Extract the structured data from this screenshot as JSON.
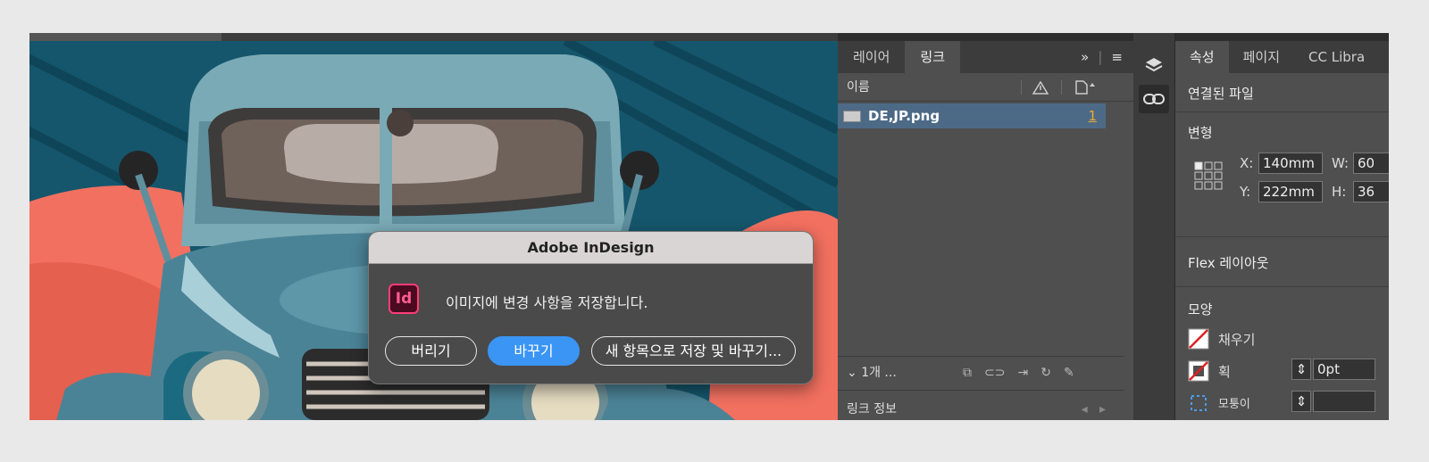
{
  "links_panel": {
    "tabs": [
      {
        "label": "레이어"
      },
      {
        "label": "링크"
      }
    ],
    "tools": {
      "expand": "»",
      "menu": "≡"
    },
    "column_name": "이름",
    "row": {
      "file_name": "DE,JP.png",
      "page": "1"
    },
    "footer": {
      "selection": "1개 ..."
    },
    "link_info": {
      "label": "링크 정보"
    }
  },
  "props_panel": {
    "tabs": [
      {
        "label": "속성"
      },
      {
        "label": "페이지"
      },
      {
        "label": "CC Libra"
      }
    ],
    "linked_file": "연결된 파일",
    "transform": {
      "title": "변형",
      "x_label": "X:",
      "x_value": "140mm",
      "w_label": "W:",
      "w_value": "60",
      "y_label": "Y:",
      "y_value": "222mm",
      "h_label": "H:",
      "h_value": "36"
    },
    "flex_layout": "Flex 레이아웃",
    "appearance": {
      "title": "모양",
      "fill_label": "채우기",
      "stroke_label": "획",
      "stroke_value": "0pt",
      "corner_label": "모퉁이"
    }
  },
  "dialog": {
    "title": "Adobe InDesign",
    "app_icon": "Id",
    "message": "이미지에 변경 사항을 저장합니다.",
    "buttons": {
      "discard": "버리기",
      "replace": "바꾸기",
      "save_as": "새 항목으로 저장 및 바꾸기..."
    }
  },
  "colors": {
    "primary_button": "#3a95f5",
    "selected_row": "#4c6a86",
    "link_count": "#f0a830"
  }
}
